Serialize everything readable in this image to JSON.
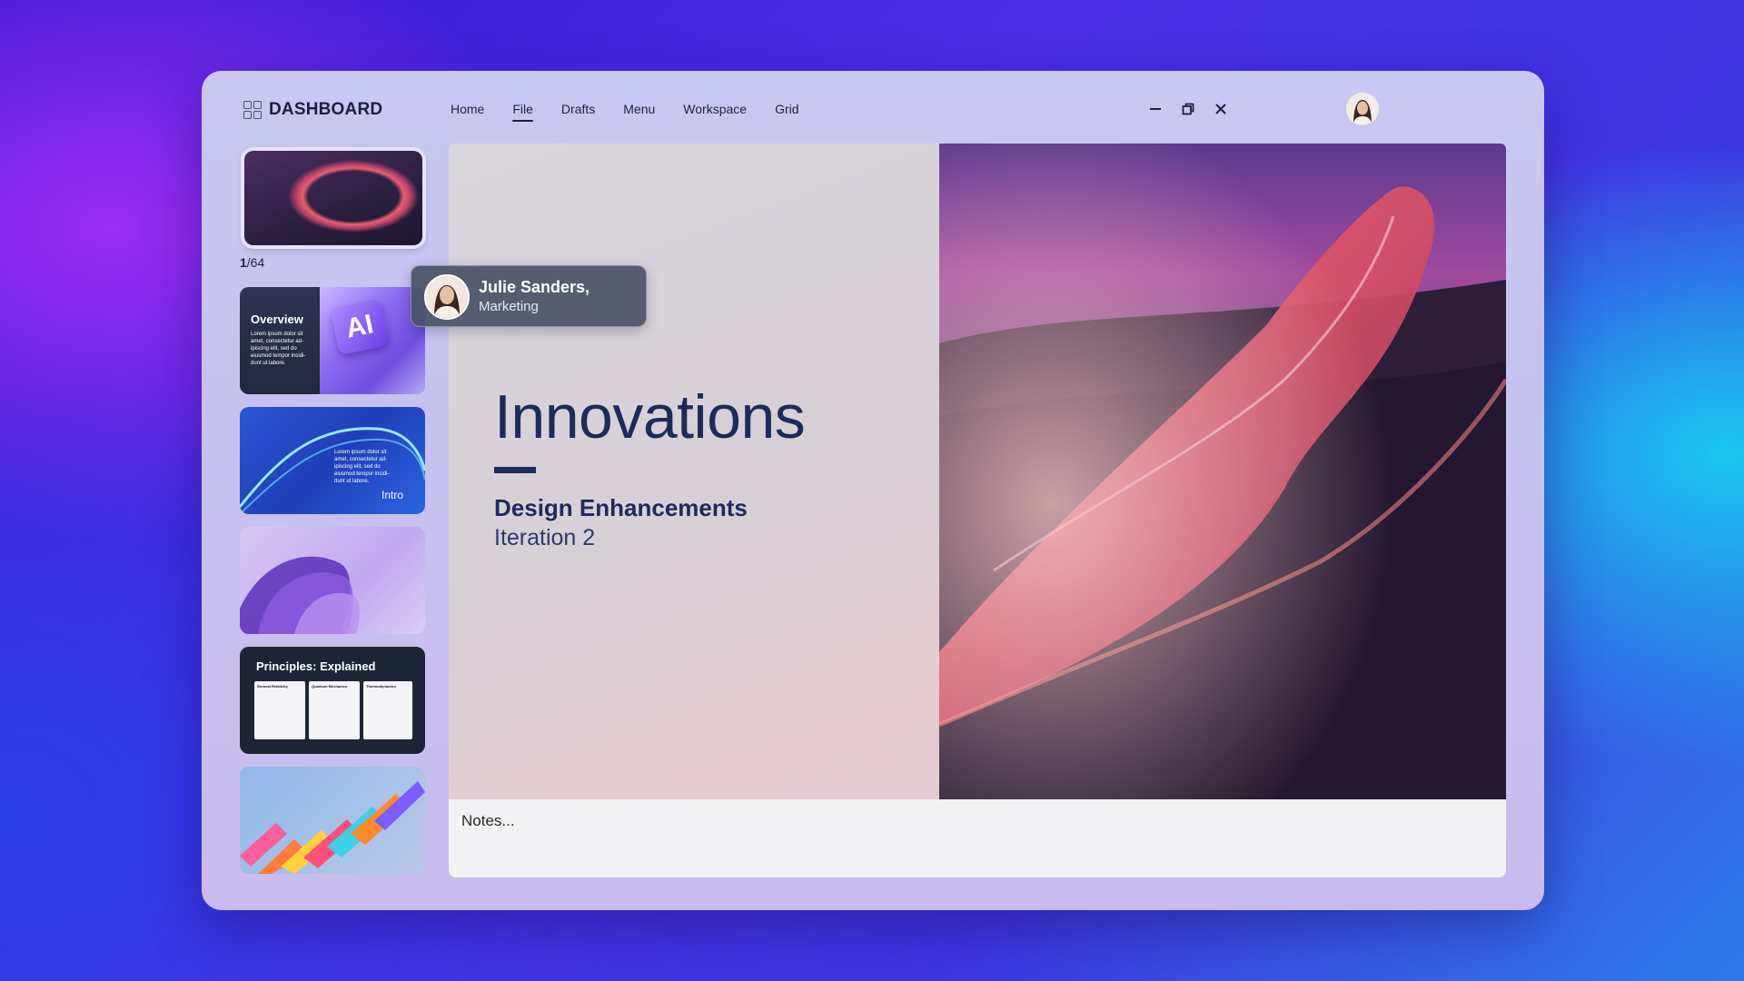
{
  "app": {
    "title": "DASHBOARD",
    "brand_icon": "grid-icon"
  },
  "nav": {
    "items": [
      "Home",
      "File",
      "Drafts",
      "Menu",
      "Workspace",
      "Grid"
    ],
    "active": "File"
  },
  "window_controls": {
    "minimize": "minimize-icon",
    "restore": "restore-icon",
    "close": "close-icon"
  },
  "sidebar": {
    "counter_current": "1",
    "counter_total": "/64",
    "thumbnails": [
      {
        "title": ""
      },
      {
        "title": "Overview",
        "body": "Lorem ipsum dolor sit amet, consectetur ad-ipiscing elit, sed do eiusmod tempor incidi-dunt ut labore.",
        "badge": "AI"
      },
      {
        "title": "Intro",
        "body": "Lorem ipsum dolor sit amet, consectetur ad-ipiscing elit, sed do eiusmod tempor incidi-dunt ut labore."
      },
      {
        "title": ""
      },
      {
        "title": "Principles: Explained",
        "cols": [
          "General Relativity",
          "Quantum Mechanics",
          "Thermodynamics"
        ]
      },
      {
        "title": ""
      }
    ]
  },
  "presenter": {
    "name": "Julie Sanders,",
    "role": "Marketing"
  },
  "slide": {
    "title": "Innovations",
    "subtitle": "Design Enhancements",
    "subtitle2": "Iteration 2"
  },
  "notes": {
    "placeholder": "Notes..."
  },
  "colors": {
    "accent": "#1e2a5a",
    "window": "#c9c8f2"
  }
}
